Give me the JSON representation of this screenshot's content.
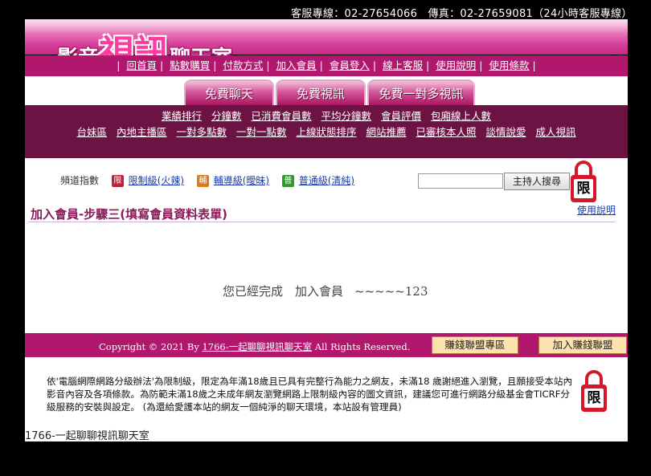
{
  "header": {
    "contact": "客服專線：02-27654066　傳真：02-27659081（24小時客服專線）",
    "logo_part1": "影音",
    "logo_part2": "視訊",
    "logo_part3": "聊天室"
  },
  "nav": [
    "回首頁",
    "點數購買",
    "付款方式",
    "加入會員",
    "會員登入",
    "線上客服",
    "使用說明",
    "使用條款"
  ],
  "tabs": [
    "免費聊天",
    "免費視訊",
    "免費一對多視訊"
  ],
  "links_row1": [
    "業績排行",
    "分鐘數",
    "已消費會員數",
    "平均分鐘數",
    "會員評價",
    "包廂線上人數"
  ],
  "links_row2": [
    "台妹區",
    "內地主播區",
    "一對多點數",
    "一對一點數",
    "上線狀態排序",
    "網站推薦",
    "已審核本人照",
    "談情說愛",
    "成人視訊"
  ],
  "rating": {
    "label": "頻道指數",
    "items": [
      {
        "badge": "限",
        "text": "限制級(火辣)",
        "color": "#c0223a"
      },
      {
        "badge": "輔",
        "text": "輔導級(曖昧)",
        "color": "#e07a14"
      },
      {
        "badge": "普",
        "text": "普通級(清純)",
        "color": "#2f9a2f"
      }
    ]
  },
  "search": {
    "placeholder": "",
    "button": "主持人搜尋"
  },
  "lock_label": "限",
  "help_link": "使用說明",
  "page_title": "加入會員-步驟三(填寫會員資料表單)",
  "message": {
    "text": "您已經完成　加入會員",
    "code": "~~~~~123"
  },
  "footer": {
    "copyright_prefix": "Copyright © 2021 By",
    "copyright_link": "1766-一起聊聊視訊聊天室",
    "copyright_suffix": "All Rights Reserved.",
    "btn_alliance": "賺錢聯盟專區",
    "btn_join": "加入賺錢聯盟"
  },
  "disclaimer": "依'電腦網際網路分級辦法'為限制級，限定為年滿18歲且已具有完整行為能力之網友，未滿18 歲謝絕進入瀏覽，且願接受本站內影音內容及各項條款。為防範未滿18歲之未成年網友瀏覽網路上限制級內容的圖文資訊，建議您可進行網路分級基金會TICRF分級服務的安裝與設定。 (為還給愛護本站的網友一個純淨的聊天環境，本站設有管理員)",
  "site_name": "1766-一起聊聊視訊聊天室"
}
